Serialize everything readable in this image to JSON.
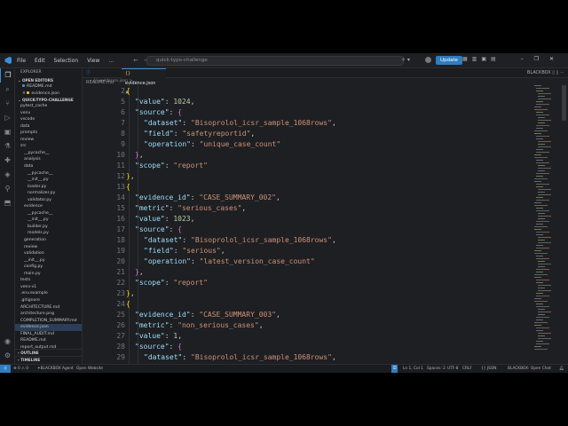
{
  "menu": [
    "File",
    "Edit",
    "Selection",
    "View",
    "…"
  ],
  "search_placeholder": "quick-typo-challenge",
  "update_label": "Update",
  "sidebar": {
    "title": "EXPLORER",
    "open_editors_label": "OPEN EDITORS",
    "open_editors": [
      "README.md",
      "evidence.json"
    ],
    "folder_label": "QUICK-TYPO-CHALLENGE",
    "tree": [
      {
        "label": "pytest_cache",
        "depth": 1
      },
      {
        "label": "venv",
        "depth": 1
      },
      {
        "label": "vscode",
        "depth": 1
      },
      {
        "label": "data",
        "depth": 1
      },
      {
        "label": "prompts",
        "depth": 1
      },
      {
        "label": "review",
        "depth": 1
      },
      {
        "label": "src",
        "depth": 1
      },
      {
        "label": "__pycache__",
        "depth": 2
      },
      {
        "label": "analysis",
        "depth": 2
      },
      {
        "label": "data",
        "depth": 2
      },
      {
        "label": "__pycache__",
        "depth": 3
      },
      {
        "label": "__init__.py",
        "depth": 3
      },
      {
        "label": "loader.py",
        "depth": 3
      },
      {
        "label": "normalizer.py",
        "depth": 3
      },
      {
        "label": "validator.py",
        "depth": 3
      },
      {
        "label": "evidence",
        "depth": 2
      },
      {
        "label": "__pycache__",
        "depth": 3
      },
      {
        "label": "__init__.py",
        "depth": 3
      },
      {
        "label": "builder.py",
        "depth": 3
      },
      {
        "label": "models.py",
        "depth": 3
      },
      {
        "label": "generation",
        "depth": 2
      },
      {
        "label": "review",
        "depth": 2
      },
      {
        "label": "validation",
        "depth": 2
      },
      {
        "label": "__init__.py",
        "depth": 2
      },
      {
        "label": "config.py",
        "depth": 2
      },
      {
        "label": "main.py",
        "depth": 2
      },
      {
        "label": "tests",
        "depth": 1
      },
      {
        "label": "venv-v1",
        "depth": 1
      },
      {
        "label": ".env.example",
        "depth": 1
      },
      {
        "label": ".gitignore",
        "depth": 1
      },
      {
        "label": "ARCHITECTURE.md",
        "depth": 1
      },
      {
        "label": "architecture.png",
        "depth": 1
      },
      {
        "label": "COMPLETION_SUMMARY.md",
        "depth": 1
      },
      {
        "label": "evidence.json",
        "depth": 1,
        "selected": true
      },
      {
        "label": "FINAL_AUDIT.md",
        "depth": 1
      },
      {
        "label": "README.md",
        "depth": 1
      },
      {
        "label": "report_output.md",
        "depth": 1
      }
    ],
    "outline_label": "OUTLINE",
    "timeline_label": "TIMELINE"
  },
  "tabs": [
    {
      "label": "README.md",
      "active": false
    },
    {
      "label": "evidence.json",
      "active": true
    }
  ],
  "tab_right_label": "BLACKBOX",
  "breadcrumb": "{} evidence.json > ...",
  "editor_lines": [
    {
      "num": "2",
      "tokens": [
        [
          "b",
          "{"
        ]
      ],
      "indent": 1
    },
    {
      "num": "5",
      "tokens": [
        [
          "k",
          "\"value\""
        ],
        [
          "p",
          ": "
        ],
        [
          "n",
          "1024"
        ],
        [
          "p",
          ","
        ]
      ],
      "indent": 2
    },
    {
      "num": "6",
      "tokens": [
        [
          "k",
          "\"source\""
        ],
        [
          "p",
          ": "
        ],
        [
          "bp",
          "{"
        ]
      ],
      "indent": 2
    },
    {
      "num": "7",
      "tokens": [
        [
          "k",
          "\"dataset\""
        ],
        [
          "p",
          ": "
        ],
        [
          "s",
          "\"Bisoprolol_icsr_sample_1068rows\""
        ],
        [
          "p",
          ","
        ]
      ],
      "indent": 3
    },
    {
      "num": "8",
      "tokens": [
        [
          "k",
          "\"field\""
        ],
        [
          "p",
          ": "
        ],
        [
          "s",
          "\"safetyreportid\""
        ],
        [
          "p",
          ","
        ]
      ],
      "indent": 3
    },
    {
      "num": "9",
      "tokens": [
        [
          "k",
          "\"operation\""
        ],
        [
          "p",
          ": "
        ],
        [
          "s",
          "\"unique_case_count\""
        ]
      ],
      "indent": 3
    },
    {
      "num": "10",
      "tokens": [
        [
          "bp",
          "}"
        ],
        [
          "p",
          ","
        ]
      ],
      "indent": 2
    },
    {
      "num": "11",
      "tokens": [
        [
          "k",
          "\"scope\""
        ],
        [
          "p",
          ": "
        ],
        [
          "s",
          "\"report\""
        ]
      ],
      "indent": 2
    },
    {
      "num": "12",
      "tokens": [
        [
          "b",
          "}"
        ],
        [
          "p",
          ","
        ]
      ],
      "indent": 1
    },
    {
      "num": "13",
      "tokens": [
        [
          "b",
          "{"
        ]
      ],
      "indent": 1
    },
    {
      "num": "14",
      "tokens": [
        [
          "k",
          "\"evidence_id\""
        ],
        [
          "p",
          ": "
        ],
        [
          "s",
          "\"CASE_SUMMARY_002\""
        ],
        [
          "p",
          ","
        ]
      ],
      "indent": 2
    },
    {
      "num": "15",
      "tokens": [
        [
          "k",
          "\"metric\""
        ],
        [
          "p",
          ": "
        ],
        [
          "s",
          "\"serious_cases\""
        ],
        [
          "p",
          ","
        ]
      ],
      "indent": 2
    },
    {
      "num": "16",
      "tokens": [
        [
          "k",
          "\"value\""
        ],
        [
          "p",
          ": "
        ],
        [
          "n",
          "1023"
        ],
        [
          "p",
          ","
        ]
      ],
      "indent": 2
    },
    {
      "num": "17",
      "tokens": [
        [
          "k",
          "\"source\""
        ],
        [
          "p",
          ": "
        ],
        [
          "bp",
          "{"
        ]
      ],
      "indent": 2
    },
    {
      "num": "18",
      "tokens": [
        [
          "k",
          "\"dataset\""
        ],
        [
          "p",
          ": "
        ],
        [
          "s",
          "\"Bisoprolol_icsr_sample_1068rows\""
        ],
        [
          "p",
          ","
        ]
      ],
      "indent": 3
    },
    {
      "num": "19",
      "tokens": [
        [
          "k",
          "\"field\""
        ],
        [
          "p",
          ": "
        ],
        [
          "s",
          "\"serious\""
        ],
        [
          "p",
          ","
        ]
      ],
      "indent": 3
    },
    {
      "num": "20",
      "tokens": [
        [
          "k",
          "\"operation\""
        ],
        [
          "p",
          ": "
        ],
        [
          "s",
          "\"latest_version_case_count\""
        ]
      ],
      "indent": 3
    },
    {
      "num": "21",
      "tokens": [
        [
          "bp",
          "}"
        ],
        [
          "p",
          ","
        ]
      ],
      "indent": 2
    },
    {
      "num": "22",
      "tokens": [
        [
          "k",
          "\"scope\""
        ],
        [
          "p",
          ": "
        ],
        [
          "s",
          "\"report\""
        ]
      ],
      "indent": 2
    },
    {
      "num": "23",
      "tokens": [
        [
          "b",
          "}"
        ],
        [
          "p",
          ","
        ]
      ],
      "indent": 1
    },
    {
      "num": "24",
      "tokens": [
        [
          "b",
          "{"
        ]
      ],
      "indent": 1
    },
    {
      "num": "25",
      "tokens": [
        [
          "k",
          "\"evidence_id\""
        ],
        [
          "p",
          ": "
        ],
        [
          "s",
          "\"CASE_SUMMARY_003\""
        ],
        [
          "p",
          ","
        ]
      ],
      "indent": 2
    },
    {
      "num": "26",
      "tokens": [
        [
          "k",
          "\"metric\""
        ],
        [
          "p",
          ": "
        ],
        [
          "s",
          "\"non_serious_cases\""
        ],
        [
          "p",
          ","
        ]
      ],
      "indent": 2
    },
    {
      "num": "27",
      "tokens": [
        [
          "k",
          "\"value\""
        ],
        [
          "p",
          ": "
        ],
        [
          "n",
          "1"
        ],
        [
          "p",
          ","
        ]
      ],
      "indent": 2
    },
    {
      "num": "28",
      "tokens": [
        [
          "k",
          "\"source\""
        ],
        [
          "p",
          ": "
        ],
        [
          "bp",
          "{"
        ]
      ],
      "indent": 2
    },
    {
      "num": "29",
      "tokens": [
        [
          "k",
          "\"dataset\""
        ],
        [
          "p",
          ": "
        ],
        [
          "s",
          "\"Bisoprolol_icsr_sample_1068rows\""
        ],
        [
          "p",
          ","
        ]
      ],
      "indent": 3
    }
  ],
  "status": {
    "left": "⊗ 0 ⚠ 0",
    "blackbox_agent": "BLACKBOX Agent",
    "open_website": "Open Website",
    "position": "Ln 1, Col 1",
    "spaces": "Spaces: 2",
    "encoding": "UTF-8",
    "eol": "CRLF",
    "language": "{} JSON",
    "blackbox_chat": "BLACKBOX: Open Chat"
  },
  "colors": {
    "key": "#9cdcfe",
    "string": "#ce9178",
    "number": "#b5cea8",
    "accent": "#2f7dbf"
  }
}
